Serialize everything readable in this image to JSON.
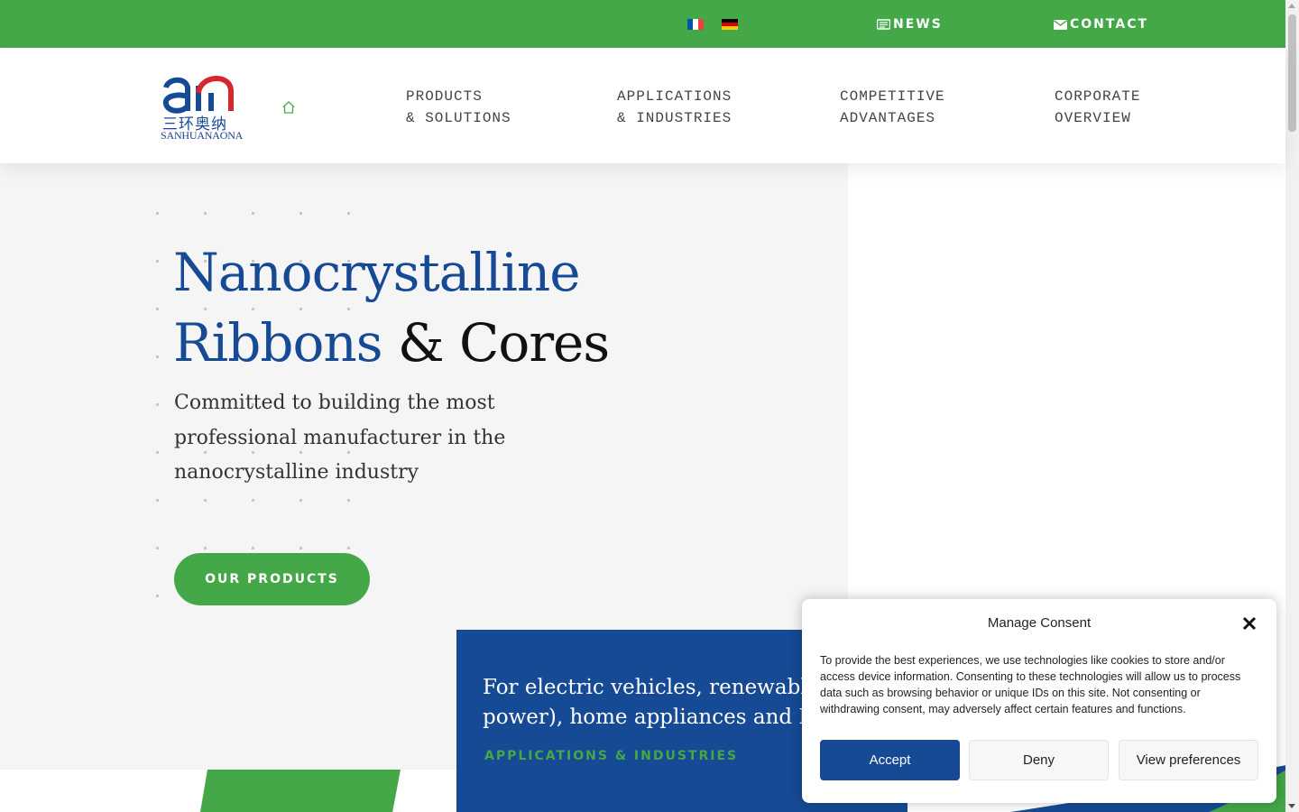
{
  "topbar": {
    "flags": [
      {
        "name": "french-flag",
        "colors": [
          "#0055a4",
          "#ffffff",
          "#ef4135"
        ]
      },
      {
        "name": "german-flag",
        "colors": [
          "#000000",
          "#dd0000",
          "#ffce00"
        ]
      }
    ],
    "news_label": "NEWS",
    "contact_label": "CONTACT"
  },
  "header": {
    "logo_text": "SANHUANAONA",
    "logo_chinese": "三环奥纳",
    "nav": [
      {
        "line1": "PRODUCTS",
        "line2": "& SOLUTIONS"
      },
      {
        "line1": "APPLICATIONS",
        "line2": "& INDUSTRIES"
      },
      {
        "line1": "COMPETITIVE",
        "line2": "ADVANTAGES"
      },
      {
        "line1": "CORPORATE",
        "line2": "OVERVIEW"
      }
    ]
  },
  "hero": {
    "title_blue_1": "Nanocrystalline",
    "title_blue_2": "Ribbons",
    "title_dark": " & Cores",
    "subtitle": "Committed to building the most professional manufacturer in the nanocrystalline industry",
    "button_label": "OUR PRODUCTS"
  },
  "infobox": {
    "line1": "For electric vehicles, renewable energy (wind",
    "line2": "power), home appliances and Industry",
    "link_label": "APPLICATIONS & INDUSTRIES"
  },
  "consent": {
    "title": "Manage Consent",
    "body": "To provide the best experiences, we use technologies like cookies to store and/or access device information. Consenting to these technologies will allow us to process data such as browsing behavior or unique IDs on this site. Not consenting or withdrawing consent, may adversely affect certain features and functions.",
    "accept_label": "Accept",
    "deny_label": "Deny",
    "preferences_label": "View preferences"
  },
  "colors": {
    "brand_green": "#44a748",
    "brand_blue": "#174a95",
    "logo_red": "#d9262c"
  }
}
